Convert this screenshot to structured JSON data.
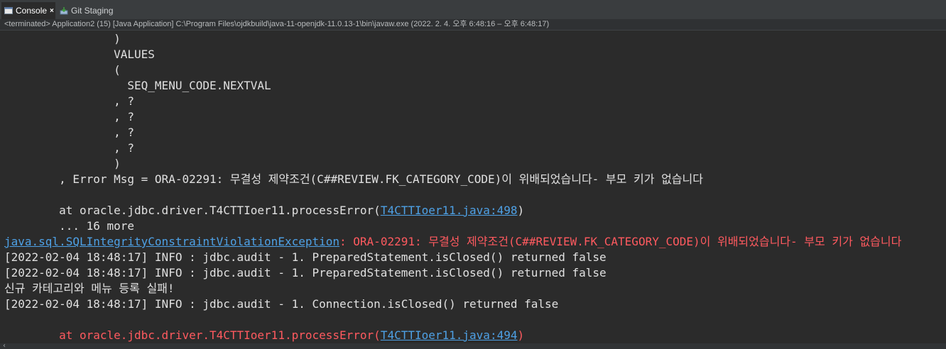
{
  "tabs": [
    {
      "label": "Console",
      "icon": "console-icon",
      "active": true,
      "close": "×"
    },
    {
      "label": "Git Staging",
      "icon": "git-staging-icon",
      "active": false
    }
  ],
  "status_line": "<terminated> Application2 (15) [Java Application] C:\\Program Files\\ojdkbuild\\java-11-openjdk-11.0.13-1\\bin\\javaw.exe  (2022. 2. 4. 오후 6:48:16 – 오후 6:48:17)",
  "console": {
    "lines": [
      {
        "text": "                )",
        "style": "std"
      },
      {
        "text": "                VALUES",
        "style": "std"
      },
      {
        "text": "                (",
        "style": "std"
      },
      {
        "text": "                  SEQ_MENU_CODE.NEXTVAL",
        "style": "std"
      },
      {
        "text": "                , ?",
        "style": "std"
      },
      {
        "text": "                , ?",
        "style": "std"
      },
      {
        "text": "                , ?",
        "style": "std"
      },
      {
        "text": "                , ?",
        "style": "std"
      },
      {
        "text": "                )",
        "style": "std"
      },
      {
        "text": "        , Error Msg = ORA-02291: 무결성 제약조건(C##REVIEW.FK_CATEGORY_CODE)이 위배되었습니다- 부모 키가 없습니다",
        "style": "std"
      },
      {
        "text": "",
        "style": "std"
      },
      {
        "text": "        at oracle.jdbc.driver.T4CTTIoer11.processError(",
        "style": "std",
        "link": "T4CTTIoer11.java:498",
        "after": ")"
      },
      {
        "text": "        ... 16 more",
        "style": "std"
      },
      {
        "prefix_link": "java.sql.SQLIntegrityConstraintViolationException",
        "text": ": ORA-02291: 무결성 제약조건(C##REVIEW.FK_CATEGORY_CODE)이 위배되었습니다- 부모 키가 없습니다",
        "style": "err"
      },
      {
        "text": "[2022-02-04 18:48:17] INFO : jdbc.audit - 1. PreparedStatement.isClosed() returned false",
        "style": "std"
      },
      {
        "text": "[2022-02-04 18:48:17] INFO : jdbc.audit - 1. PreparedStatement.isClosed() returned false",
        "style": "std"
      },
      {
        "text": "신규 카테고리와 메뉴 등록 실패!",
        "style": "std"
      },
      {
        "text": "[2022-02-04 18:48:17] INFO : jdbc.audit - 1. Connection.isClosed() returned false",
        "style": "std"
      },
      {
        "text": "",
        "style": "std"
      },
      {
        "text": "        at oracle.jdbc.driver.T4CTTIoer11.processError(",
        "style": "err",
        "link": "T4CTTIoer11.java:494",
        "after": ")"
      }
    ]
  },
  "colors": {
    "background": "#2b2b2b",
    "stdout": "#e0e0e0",
    "stderr": "#ff5a5f",
    "link": "#4ea1e6"
  }
}
